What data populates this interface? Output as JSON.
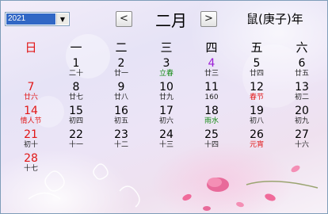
{
  "header": {
    "year": "2021",
    "prev_label": "<",
    "next_label": ">",
    "month": "二月",
    "zodiac": "鼠(庚子)年"
  },
  "weekdays": [
    "日",
    "一",
    "二",
    "三",
    "四",
    "五",
    "六"
  ],
  "days": [
    {
      "n": "1",
      "l": "二十",
      "t": "plain"
    },
    {
      "n": "2",
      "l": "廿一",
      "t": "plain"
    },
    {
      "n": "3",
      "l": "立春",
      "t": "term"
    },
    {
      "n": "4",
      "l": "廿三",
      "t": "plain"
    },
    {
      "n": "5",
      "l": "廿四",
      "t": "plain"
    },
    {
      "n": "6",
      "l": "廿五",
      "t": "plain"
    },
    {
      "n": "7",
      "l": "廿六",
      "t": "plain"
    },
    {
      "n": "8",
      "l": "廿七",
      "t": "plain"
    },
    {
      "n": "9",
      "l": "廿八",
      "t": "plain"
    },
    {
      "n": "10",
      "l": "廿九",
      "t": "plain"
    },
    {
      "n": "11",
      "l": "160",
      "t": "plain"
    },
    {
      "n": "12",
      "l": "春节",
      "t": "fest"
    },
    {
      "n": "13",
      "l": "初二",
      "t": "plain"
    },
    {
      "n": "14",
      "l": "情人节",
      "t": "fest"
    },
    {
      "n": "15",
      "l": "初四",
      "t": "plain"
    },
    {
      "n": "16",
      "l": "初五",
      "t": "plain"
    },
    {
      "n": "17",
      "l": "初六",
      "t": "plain"
    },
    {
      "n": "18",
      "l": "雨水",
      "t": "term"
    },
    {
      "n": "19",
      "l": "初八",
      "t": "plain"
    },
    {
      "n": "20",
      "l": "初九",
      "t": "plain"
    },
    {
      "n": "21",
      "l": "初十",
      "t": "plain"
    },
    {
      "n": "22",
      "l": "十一",
      "t": "plain"
    },
    {
      "n": "23",
      "l": "十二",
      "t": "plain"
    },
    {
      "n": "24",
      "l": "十三",
      "t": "plain"
    },
    {
      "n": "25",
      "l": "十四",
      "t": "plain"
    },
    {
      "n": "26",
      "l": "元宵",
      "t": "fest"
    },
    {
      "n": "27",
      "l": "十六",
      "t": "plain"
    },
    {
      "n": "28",
      "l": "十七",
      "t": "plain"
    }
  ],
  "today": "4",
  "icons": {
    "year_dropdown": "chevron-down-icon",
    "prev": "chevron-left-icon",
    "next": "chevron-right-icon"
  },
  "colors": {
    "sunday": "#e11616",
    "solar_term": "#128a12",
    "festival": "#e11616",
    "today": "#9c1fd6",
    "year_highlight": "#3167c5"
  }
}
